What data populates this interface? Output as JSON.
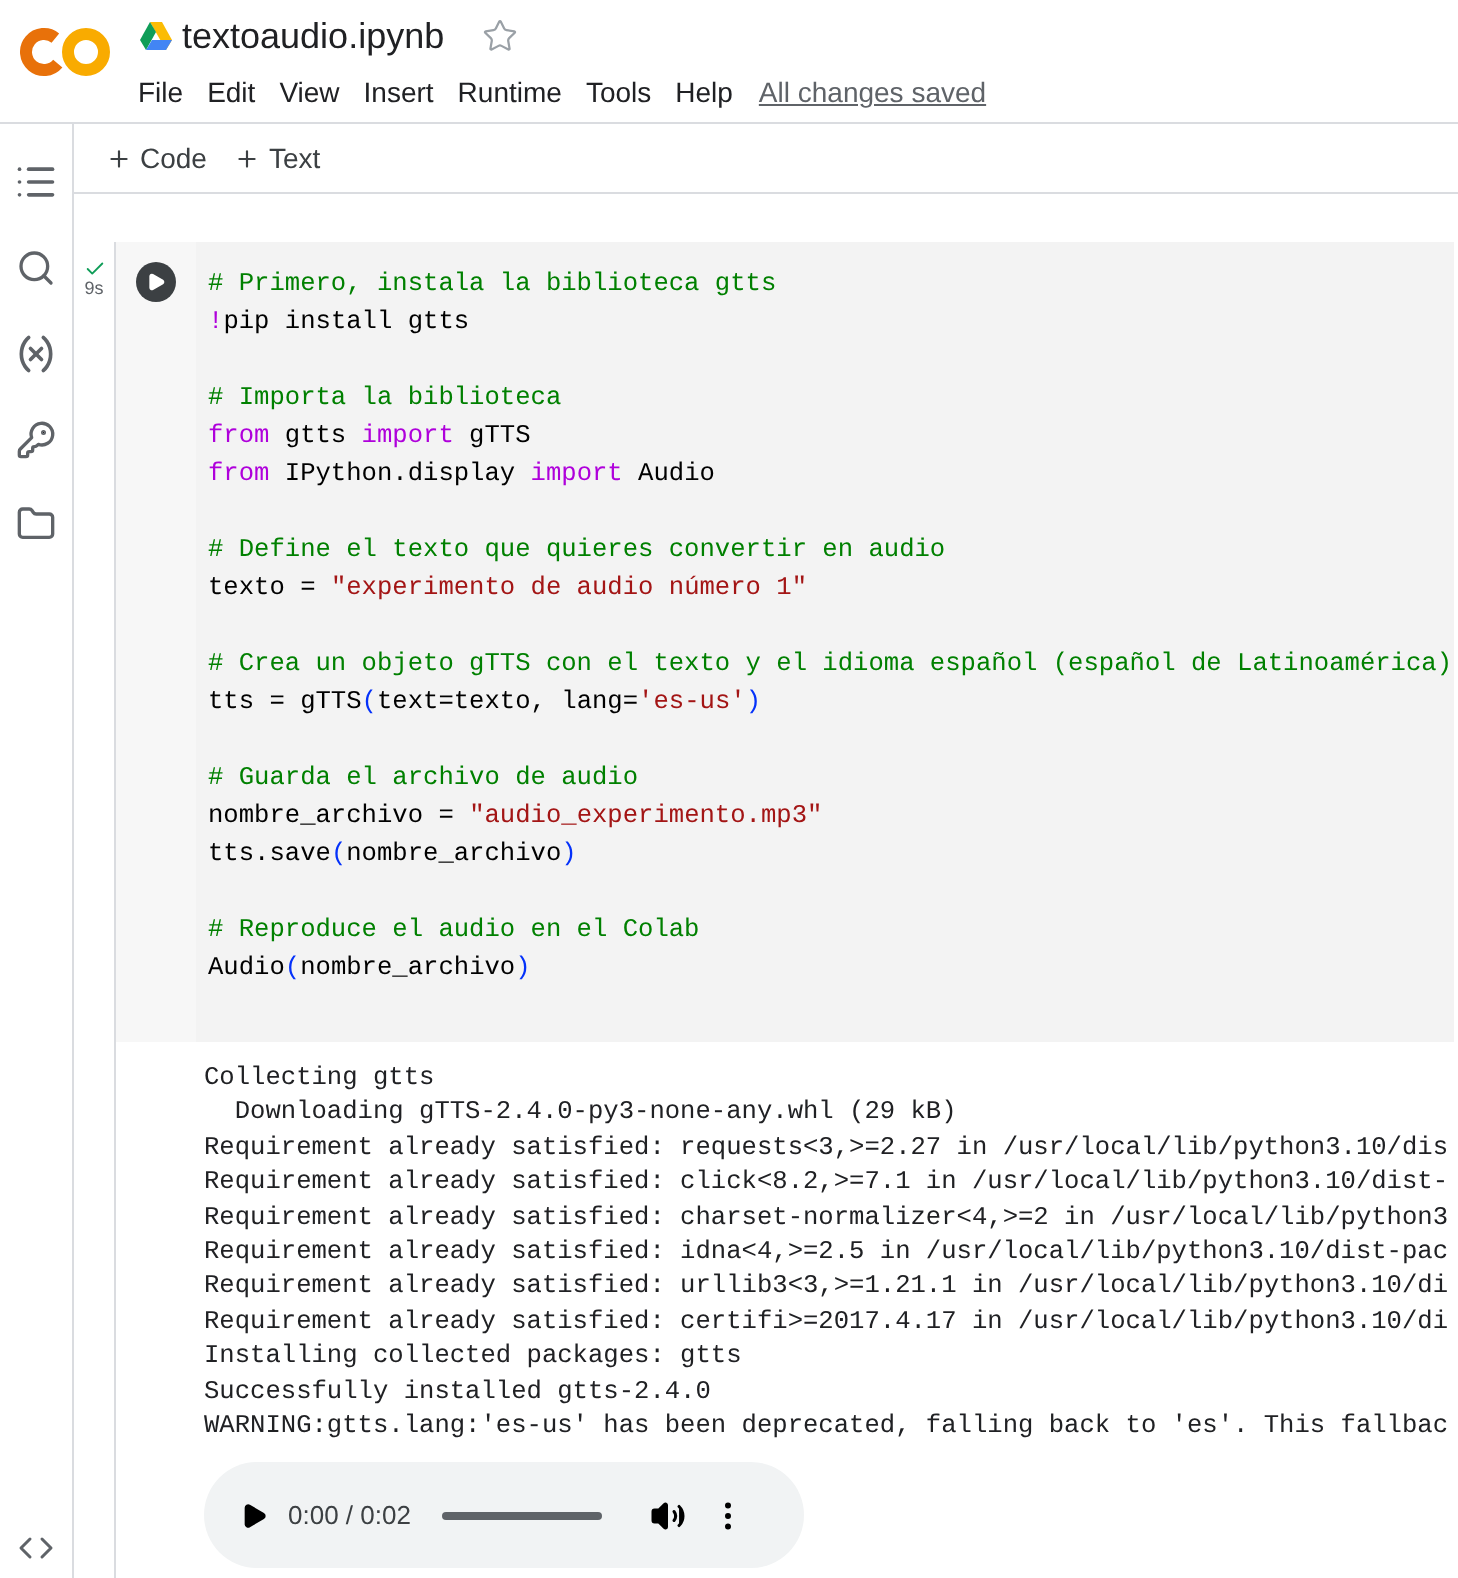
{
  "notebook": {
    "title": "textoaudio.ipynb",
    "starred": false
  },
  "menu": [
    "File",
    "Edit",
    "View",
    "Insert",
    "Runtime",
    "Tools",
    "Help"
  ],
  "save_status": "All changes saved",
  "toolbar": [
    "Code",
    "Text"
  ],
  "cell": {
    "executed": true,
    "duration": "9s",
    "code_lines": [
      {
        "kind": "code",
        "tokens": [
          {
            "kind": "comment",
            "text": "# Primero, instala la biblioteca gtts"
          }
        ]
      },
      {
        "kind": "code",
        "tokens": [
          {
            "kind": "magic",
            "text": "!"
          },
          {
            "kind": "plain",
            "text": "pip install gtts"
          }
        ]
      },
      {
        "kind": "blank"
      },
      {
        "kind": "code",
        "tokens": [
          {
            "kind": "comment",
            "text": "# Importa la biblioteca"
          }
        ]
      },
      {
        "kind": "code",
        "tokens": [
          {
            "kind": "keyword",
            "text": "from"
          },
          {
            "kind": "plain",
            "text": " gtts "
          },
          {
            "kind": "keyword",
            "text": "import"
          },
          {
            "kind": "plain",
            "text": " gTTS"
          }
        ]
      },
      {
        "kind": "code",
        "tokens": [
          {
            "kind": "keyword",
            "text": "from"
          },
          {
            "kind": "plain",
            "text": " IPython.display "
          },
          {
            "kind": "keyword",
            "text": "import"
          },
          {
            "kind": "plain",
            "text": " Audio"
          }
        ]
      },
      {
        "kind": "blank"
      },
      {
        "kind": "code",
        "tokens": [
          {
            "kind": "comment",
            "text": "# Define el texto que quieres convertir en audio"
          }
        ]
      },
      {
        "kind": "code",
        "tokens": [
          {
            "kind": "plain",
            "text": "texto = "
          },
          {
            "kind": "string",
            "text": "\"experimento de audio número 1\""
          }
        ]
      },
      {
        "kind": "blank"
      },
      {
        "kind": "code",
        "tokens": [
          {
            "kind": "comment",
            "text": "# Crea un objeto gTTS con el texto y el idioma español (español de Latinoamérica)"
          }
        ]
      },
      {
        "kind": "code",
        "tokens": [
          {
            "kind": "plain",
            "text": "tts = gTTS"
          },
          {
            "kind": "paren",
            "text": "("
          },
          {
            "kind": "plain",
            "text": "text=texto, lang="
          },
          {
            "kind": "string",
            "text": "'es-us'"
          },
          {
            "kind": "paren",
            "text": ")"
          }
        ]
      },
      {
        "kind": "blank"
      },
      {
        "kind": "code",
        "tokens": [
          {
            "kind": "comment",
            "text": "# Guarda el archivo de audio"
          }
        ]
      },
      {
        "kind": "code",
        "tokens": [
          {
            "kind": "plain",
            "text": "nombre_archivo = "
          },
          {
            "kind": "string",
            "text": "\"audio_experimento.mp3\""
          }
        ]
      },
      {
        "kind": "code",
        "tokens": [
          {
            "kind": "plain",
            "text": "tts.save"
          },
          {
            "kind": "paren",
            "text": "("
          },
          {
            "kind": "plain",
            "text": "nombre_archivo"
          },
          {
            "kind": "paren",
            "text": ")"
          }
        ]
      },
      {
        "kind": "blank"
      },
      {
        "kind": "code",
        "tokens": [
          {
            "kind": "comment",
            "text": "# Reproduce el audio en el Colab"
          }
        ]
      },
      {
        "kind": "code",
        "tokens": [
          {
            "kind": "plain",
            "text": "Audio"
          },
          {
            "kind": "paren",
            "text": "("
          },
          {
            "kind": "plain",
            "text": "nombre_archivo"
          },
          {
            "kind": "paren",
            "text": ")"
          }
        ]
      }
    ],
    "output_lines": [
      "Collecting gtts",
      "  Downloading gTTS-2.4.0-py3-none-any.whl (29 kB)",
      "Requirement already satisfied: requests<3,>=2.27 in /usr/local/lib/python3.10/dis",
      "Requirement already satisfied: click<8.2,>=7.1 in /usr/local/lib/python3.10/dist-",
      "Requirement already satisfied: charset-normalizer<4,>=2 in /usr/local/lib/python3",
      "Requirement already satisfied: idna<4,>=2.5 in /usr/local/lib/python3.10/dist-pac",
      "Requirement already satisfied: urllib3<3,>=1.21.1 in /usr/local/lib/python3.10/di",
      "Requirement already satisfied: certifi>=2017.4.17 in /usr/local/lib/python3.10/di",
      "Installing collected packages: gtts",
      "Successfully installed gtts-2.4.0",
      "WARNING:gtts.lang:'es-us' has been deprecated, falling back to 'es'. This fallbac"
    ],
    "audio": {
      "time": "0:00 / 0:02"
    }
  }
}
